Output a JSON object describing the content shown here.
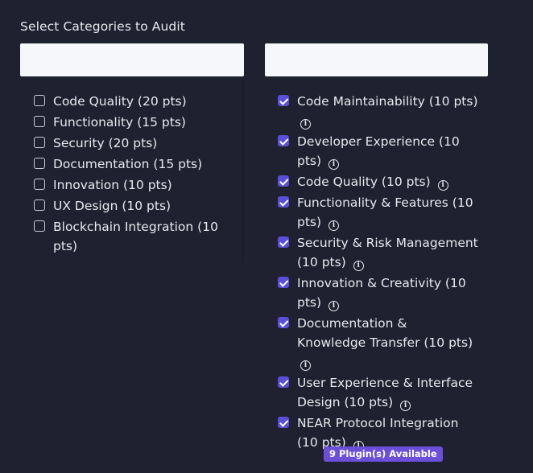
{
  "heading": "Select Categories to Audit",
  "search_left": {
    "value": "",
    "placeholder": ""
  },
  "search_right": {
    "value": "",
    "placeholder": ""
  },
  "left_categories": [
    {
      "label": "Code Quality (20 pts)",
      "checked": false
    },
    {
      "label": "Functionality (15 pts)",
      "checked": false
    },
    {
      "label": "Security (20 pts)",
      "checked": false
    },
    {
      "label": "Documentation (15 pts)",
      "checked": false
    },
    {
      "label": "Innovation (10 pts)",
      "checked": false
    },
    {
      "label": "UX Design (10 pts)",
      "checked": false
    },
    {
      "label": "Blockchain Integration (10 pts)",
      "checked": false
    }
  ],
  "right_plugins": [
    {
      "label": "Code Maintainability (10 pts)",
      "checked": true,
      "icon": "info-icon"
    },
    {
      "label": "Developer Experience (10 pts)",
      "checked": true,
      "icon": "info-icon"
    },
    {
      "label": "Code Quality (10 pts)",
      "checked": true,
      "icon": "info-icon"
    },
    {
      "label": "Functionality & Features (10 pts)",
      "checked": true,
      "icon": "info-icon"
    },
    {
      "label": "Security & Risk Management (10 pts)",
      "checked": true,
      "icon": "info-icon"
    },
    {
      "label": "Innovation & Creativity (10 pts)",
      "checked": true,
      "icon": "info-icon"
    },
    {
      "label": "Documentation & Knowledge Transfer (10 pts)",
      "checked": true,
      "icon": "info-icon"
    },
    {
      "label": "User Experience & Interface Design (10 pts)",
      "checked": true,
      "icon": "info-icon"
    },
    {
      "label": "NEAR Protocol Integration (10 pts)",
      "checked": true,
      "icon": "info-icon"
    }
  ],
  "badge": "9 Plugin(s) Available",
  "colors": {
    "background": "#1f2130",
    "checkbox_checked": "#5a4fd8",
    "badge": "#6b4fd8"
  }
}
